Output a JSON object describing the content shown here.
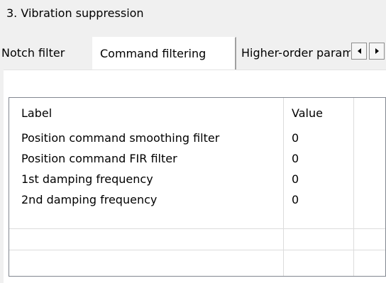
{
  "section": {
    "title": "3. Vibration suppression"
  },
  "tabs": [
    {
      "label": "Notch filter",
      "selected": false
    },
    {
      "label": "Command filtering",
      "selected": true
    },
    {
      "label": "Higher-order parameters",
      "selected": false
    }
  ],
  "tab_scroll": {
    "left_icon": "arrow-left-icon",
    "right_icon": "arrow-right-icon"
  },
  "table": {
    "columns": [
      "Label",
      "Value"
    ],
    "rows": [
      {
        "label": "Position command smoothing filter",
        "value": "0"
      },
      {
        "label": "Position command FIR filter",
        "value": "0"
      },
      {
        "label": "1st damping frequency",
        "value": "0"
      },
      {
        "label": "2nd damping frequency",
        "value": "0"
      }
    ]
  }
}
